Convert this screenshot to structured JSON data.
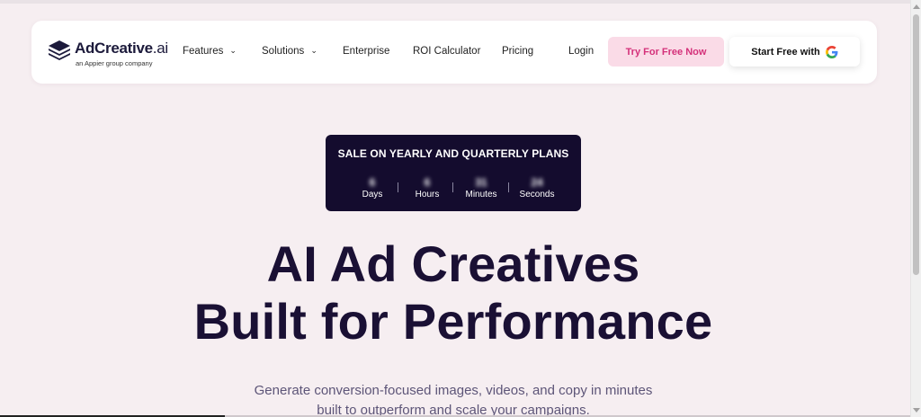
{
  "brand": {
    "name": "AdCreative",
    "suffix": ".ai",
    "tagline": "an Appier group company"
  },
  "nav": {
    "features": "Features",
    "solutions": "Solutions",
    "enterprise": "Enterprise",
    "roi": "ROI Calculator",
    "pricing": "Pricing",
    "login": "Login",
    "try_free": "Try For Free Now",
    "start_google": "Start Free with",
    "chevron": "⌄"
  },
  "sale": {
    "title": "SALE ON YEARLY AND QUARTERLY PLANS",
    "days_value": "6",
    "days_label": "Days",
    "hours_value": "6",
    "hours_label": "Hours",
    "minutes_value": "31",
    "minutes_label": "Minutes",
    "seconds_value": "24",
    "seconds_label": "Seconds"
  },
  "hero": {
    "title_line1": "AI Ad Creatives",
    "title_line2": "Built for Performance",
    "subtitle_line1": "Generate conversion-focused images, videos, and copy in minutes",
    "subtitle_line2": "built to outperform and scale your campaigns."
  },
  "colors": {
    "page_bg": "#f6eef1",
    "dark_navy": "#1a1034",
    "accent_pink": "#d4317a",
    "pink_bg": "#fadbe7"
  }
}
